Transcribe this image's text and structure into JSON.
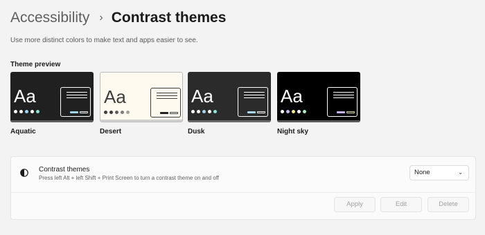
{
  "header": {
    "parent": "Accessibility",
    "separator": "›",
    "title": "Contrast themes",
    "description": "Use more distinct colors to make text and apps easier to see."
  },
  "preview": {
    "label": "Theme preview",
    "themes": [
      {
        "name": "Aquatic",
        "aa": "Aa",
        "bg": "#202020",
        "fg": "#ffffff",
        "bar": "#5c5c5c",
        "dots": [
          "#ffffff",
          "#ffffff",
          "#9ad6f3",
          "#ffffff",
          "#8ae2d7"
        ],
        "btn1": "#9bd8f5",
        "btn2": "#ffffff"
      },
      {
        "name": "Desert",
        "aa": "Aa",
        "bg": "#fffaef",
        "fg": "#3d3d3d",
        "bar": "#cfcfcf",
        "dots": [
          "#3d3d3d",
          "#3d3d3d",
          "#5e5e5e",
          "#7c7c7c",
          "#a1a1a1"
        ],
        "btn1": "#202020",
        "btn2": "#3d3d3d"
      },
      {
        "name": "Dusk",
        "aa": "Aa",
        "bg": "#2b2b2b",
        "fg": "#ffffff",
        "bar": "#6a6a6a",
        "dots": [
          "#ffffff",
          "#ffffff",
          "#a8d3ee",
          "#ffffff",
          "#8de4df"
        ],
        "btn1": "#a9d9f5",
        "btn2": "#ffffff"
      },
      {
        "name": "Night sky",
        "aa": "Aa",
        "bg": "#000000",
        "fg": "#ffffff",
        "bar": "#5a5a5a",
        "dots": [
          "#ffffff",
          "#c8b6f6",
          "#f3e88a",
          "#ffffff",
          "#a4f0bf"
        ],
        "btn1": "#c7b4f5",
        "btn2": "#d9d9a5"
      }
    ]
  },
  "contrast": {
    "title": "Contrast themes",
    "subtitle": "Press left Alt + left Shift + Print Screen to turn a contrast theme on and off",
    "selected": "None",
    "chevron": "⌄",
    "apply_label": "Apply",
    "edit_label": "Edit",
    "delete_label": "Delete"
  },
  "icons": {
    "contrast": "contrast-icon",
    "chevron": "chevron-down-icon"
  }
}
